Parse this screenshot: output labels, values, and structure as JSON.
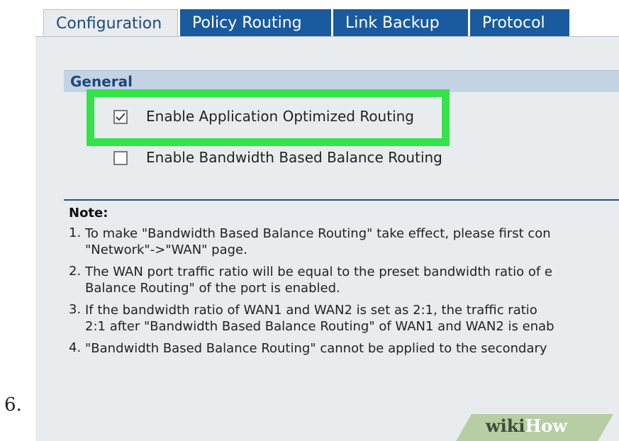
{
  "step_number": "6.",
  "tabs": [
    {
      "label": "Configuration",
      "active": true
    },
    {
      "label": "Policy Routing",
      "active": false
    },
    {
      "label": "Link Backup",
      "active": false
    },
    {
      "label": "Protocol",
      "active": false
    }
  ],
  "general": {
    "title": "General",
    "options": [
      {
        "label": "Enable Application Optimized Routing",
        "checked": true,
        "highlighted": true
      },
      {
        "label": "Enable Bandwidth Based Balance Routing",
        "checked": false,
        "highlighted": false
      }
    ]
  },
  "note": {
    "title": "Note:",
    "items": [
      {
        "num": "1.",
        "lines": [
          "To make \"Bandwidth Based Balance Routing\" take effect, please first con",
          "\"Network\"->\"WAN\" page."
        ]
      },
      {
        "num": "2.",
        "lines": [
          "The WAN port traffic ratio will be equal to the preset bandwidth ratio of e",
          "Balance Routing\" of the port is enabled."
        ]
      },
      {
        "num": "3.",
        "lines": [
          "If the bandwidth ratio of WAN1 and WAN2 is set as 2:1, the traffic ratio",
          "2:1 after \"Bandwidth Based Balance Routing\" of WAN1 and WAN2 is enab"
        ]
      },
      {
        "num": "4.",
        "lines": [
          "\"Bandwidth Based Balance Routing\" cannot be applied to the secondary"
        ]
      }
    ]
  },
  "watermark": {
    "wiki": "wiki",
    "how": "How"
  },
  "colors": {
    "tab_active_bg": "#e9ecef",
    "tab_inactive_bg": "#1a5a9e",
    "section_header_bg": "#c4d3e4",
    "highlight": "#34e24a",
    "divider": "#2a527d"
  }
}
